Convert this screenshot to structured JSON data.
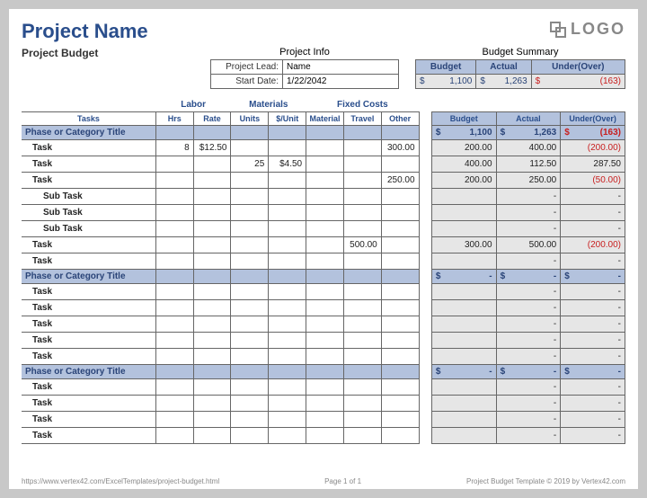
{
  "title": "Project Name",
  "logo_text": "LOGO",
  "subtitle": "Project Budget",
  "project_info": {
    "heading": "Project Info",
    "lead_label": "Project Lead:",
    "lead_value": "Name",
    "date_label": "Start Date:",
    "date_value": "1/22/2042"
  },
  "budget_summary": {
    "heading": "Budget Summary",
    "cols": [
      "Budget",
      "Actual",
      "Under(Over)"
    ],
    "budget": "1,100",
    "actual": "1,263",
    "under": "(163)"
  },
  "groups": {
    "labor": "Labor",
    "materials": "Materials",
    "fixed": "Fixed Costs"
  },
  "cols": {
    "tasks": "Tasks",
    "hrs": "Hrs",
    "rate": "Rate",
    "units": "Units",
    "unit_price": "$/Unit",
    "material": "Material",
    "travel": "Travel",
    "other": "Other",
    "budget": "Budget",
    "actual": "Actual",
    "under": "Under(Over)"
  },
  "phase_title": "Phase or Category Title",
  "task_label": "Task",
  "sub_task_label": "Sub Task",
  "phase1_totals": {
    "budget": "1,100",
    "actual": "1,263",
    "under": "(163)"
  },
  "rows1": [
    {
      "task": "Task",
      "hrs": "8",
      "rate": "$12.50",
      "other": "300.00",
      "budget": "200.00",
      "actual": "400.00",
      "under": "(200.00)",
      "neg": true
    },
    {
      "task": "Task",
      "units": "25",
      "uprice": "$4.50",
      "budget": "400.00",
      "actual": "112.50",
      "under": "287.50"
    },
    {
      "task": "Task",
      "other": "250.00",
      "budget": "200.00",
      "actual": "250.00",
      "under": "(50.00)",
      "neg": true
    },
    {
      "task": "Sub Task",
      "sub": true,
      "actual": "-",
      "under": "-"
    },
    {
      "task": "Sub Task",
      "sub": true,
      "actual": "-",
      "under": "-"
    },
    {
      "task": "Sub Task",
      "sub": true,
      "actual": "-",
      "under": "-"
    },
    {
      "task": "Task",
      "travel": "500.00",
      "budget": "300.00",
      "actual": "500.00",
      "under": "(200.00)",
      "neg": true
    },
    {
      "task": "Task",
      "actual": "-",
      "under": "-"
    }
  ],
  "rows2_count": 5,
  "rows3_count": 4,
  "dash": "-",
  "currency": "$",
  "footer": {
    "left": "https://www.vertex42.com/ExcelTemplates/project-budget.html",
    "center": "Page 1 of 1",
    "right": "Project Budget Template © 2019 by Vertex42.com"
  }
}
